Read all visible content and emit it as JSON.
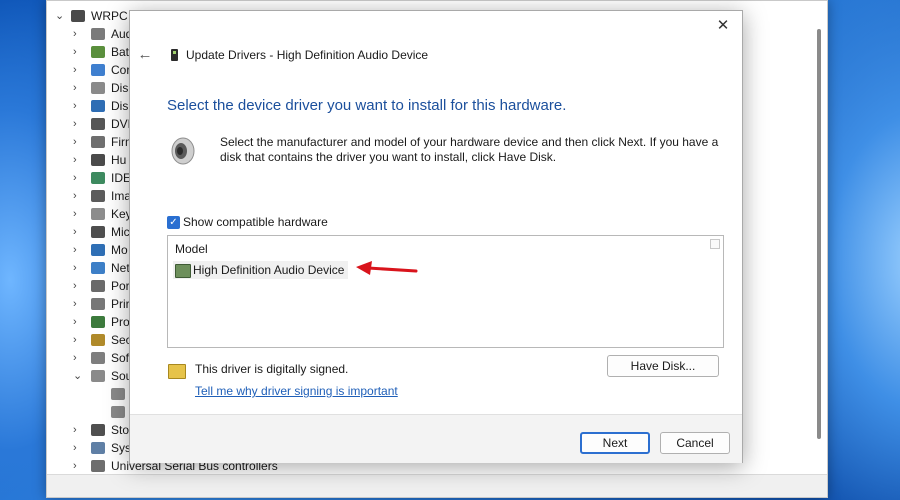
{
  "device_manager": {
    "root_label": "WRPC",
    "categories": [
      {
        "label": "Audi",
        "color": "#7a7a7a"
      },
      {
        "label": "Batt",
        "color": "#5a8f3c"
      },
      {
        "label": "Cor",
        "color": "#3f7fcf"
      },
      {
        "label": "Disk",
        "color": "#8a8a8a"
      },
      {
        "label": "Disp",
        "color": "#2e6db4"
      },
      {
        "label": "DVD",
        "color": "#555555"
      },
      {
        "label": "Firm",
        "color": "#6e6e6e"
      },
      {
        "label": "Hu",
        "color": "#4a4a4a"
      },
      {
        "label": "IDE",
        "color": "#3d8a5f"
      },
      {
        "label": "Ima",
        "color": "#5b5b5b"
      },
      {
        "label": "Key",
        "color": "#8c8c8c"
      },
      {
        "label": "Mic",
        "color": "#4e4e4e"
      },
      {
        "label": "Mo",
        "color": "#2f6fb5"
      },
      {
        "label": "Net",
        "color": "#3d7fc7"
      },
      {
        "label": "Por",
        "color": "#6a6a6a"
      },
      {
        "label": "Prir",
        "color": "#777777"
      },
      {
        "label": "Pro",
        "color": "#3c7a3c"
      },
      {
        "label": "Sec",
        "color": "#b08a2a"
      },
      {
        "label": "Soft",
        "color": "#7e7e7e"
      },
      {
        "label": "Sou",
        "color": "#8a8a8a"
      }
    ],
    "sound_children": [
      "",
      ""
    ],
    "more_categories": [
      {
        "label": "Stor",
        "color": "#4f4f4f"
      },
      {
        "label": "Syst",
        "color": "#5f7fa5"
      },
      {
        "label": "Universal Serial Bus controllers",
        "color": "#6d6d6d"
      }
    ]
  },
  "dialog": {
    "title": "Update Drivers - High Definition Audio Device",
    "heading": "Select the device driver you want to install for this hardware.",
    "description": "Select the manufacturer and model of your hardware device and then click Next. If you have a disk that contains the driver you want to install, click Have Disk.",
    "show_compatible_label": "Show compatible hardware",
    "show_compatible_checked": true,
    "model_header": "Model",
    "model_items": [
      "High Definition Audio Device"
    ],
    "signed_text": "This driver is digitally signed.",
    "signing_link": "Tell me why driver signing is important",
    "have_disk_label": "Have Disk...",
    "next_label": "Next",
    "cancel_label": "Cancel",
    "close_glyph": "✕",
    "back_glyph": "←",
    "check_glyph": "✓",
    "icons": {
      "title": "device-icon",
      "speaker": "speaker-icon",
      "model_item": "audio-device-icon",
      "signed": "certificate-icon"
    }
  },
  "annotation": {
    "arrow_color": "#d9141c"
  }
}
